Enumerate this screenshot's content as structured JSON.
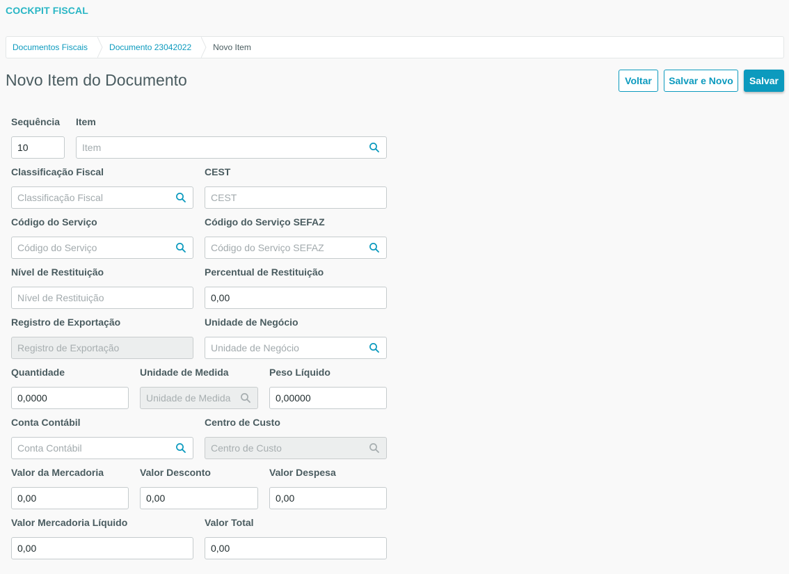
{
  "app": {
    "title": "COCKPIT FISCAL"
  },
  "breadcrumb": [
    "Documentos Fiscais",
    "Documento 23042022",
    "Novo Item"
  ],
  "page": {
    "title": "Novo Item do Documento"
  },
  "actions": {
    "back": "Voltar",
    "save_new": "Salvar e Novo",
    "save": "Salvar"
  },
  "colors": {
    "accent": "#0c9abe",
    "title": "#29b6c5",
    "text": "#4a5c60",
    "disabled_bg": "#eceeee"
  },
  "form": {
    "sequencia": {
      "label": "Sequência",
      "value": "10",
      "placeholder": ""
    },
    "item": {
      "label": "Item",
      "value": "",
      "placeholder": "Item",
      "icon": "search-icon"
    },
    "classificacao": {
      "label": "Classificação Fiscal",
      "value": "",
      "placeholder": "Classificação Fiscal",
      "icon": "search-icon"
    },
    "cest": {
      "label": "CEST",
      "value": "",
      "placeholder": "CEST"
    },
    "codigo_servico": {
      "label": "Código do Serviço",
      "value": "",
      "placeholder": "Código do Serviço",
      "icon": "search-icon"
    },
    "codigo_sefaz": {
      "label": "Código do Serviço SEFAZ",
      "value": "",
      "placeholder": "Código do Serviço SEFAZ",
      "icon": "search-icon"
    },
    "nivel_restituicao": {
      "label": "Nível de Restituição",
      "value": "",
      "placeholder": "Nível de Restituição"
    },
    "perc_restituicao": {
      "label": "Percentual de Restituição",
      "value": "0,00",
      "placeholder": ""
    },
    "registro_export": {
      "label": "Registro de Exportação",
      "value": "",
      "placeholder": "Registro de Exportação",
      "disabled": true
    },
    "unidade_negocio": {
      "label": "Unidade de Negócio",
      "value": "",
      "placeholder": "Unidade de Negócio",
      "icon": "search-icon"
    },
    "quantidade": {
      "label": "Quantidade",
      "value": "0,0000",
      "placeholder": ""
    },
    "unidade_medida": {
      "label": "Unidade de Medida",
      "value": "",
      "placeholder": "Unidade de Medida",
      "icon": "search-icon",
      "disabled": true
    },
    "peso_liquido": {
      "label": "Peso Líquido",
      "value": "0,00000",
      "placeholder": ""
    },
    "conta_contabil": {
      "label": "Conta Contábil",
      "value": "",
      "placeholder": "Conta Contábil",
      "icon": "search-icon"
    },
    "centro_custo": {
      "label": "Centro de Custo",
      "value": "",
      "placeholder": "Centro de Custo",
      "icon": "search-icon",
      "disabled": true
    },
    "valor_mercadoria": {
      "label": "Valor da Mercadoria",
      "value": "0,00",
      "placeholder": ""
    },
    "valor_desconto": {
      "label": "Valor Desconto",
      "value": "0,00",
      "placeholder": ""
    },
    "valor_despesa": {
      "label": "Valor Despesa",
      "value": "0,00",
      "placeholder": ""
    },
    "valor_merc_liq": {
      "label": "Valor Mercadoria Líquido",
      "value": "0,00",
      "placeholder": ""
    },
    "valor_total": {
      "label": "Valor Total",
      "value": "0,00",
      "placeholder": ""
    }
  }
}
